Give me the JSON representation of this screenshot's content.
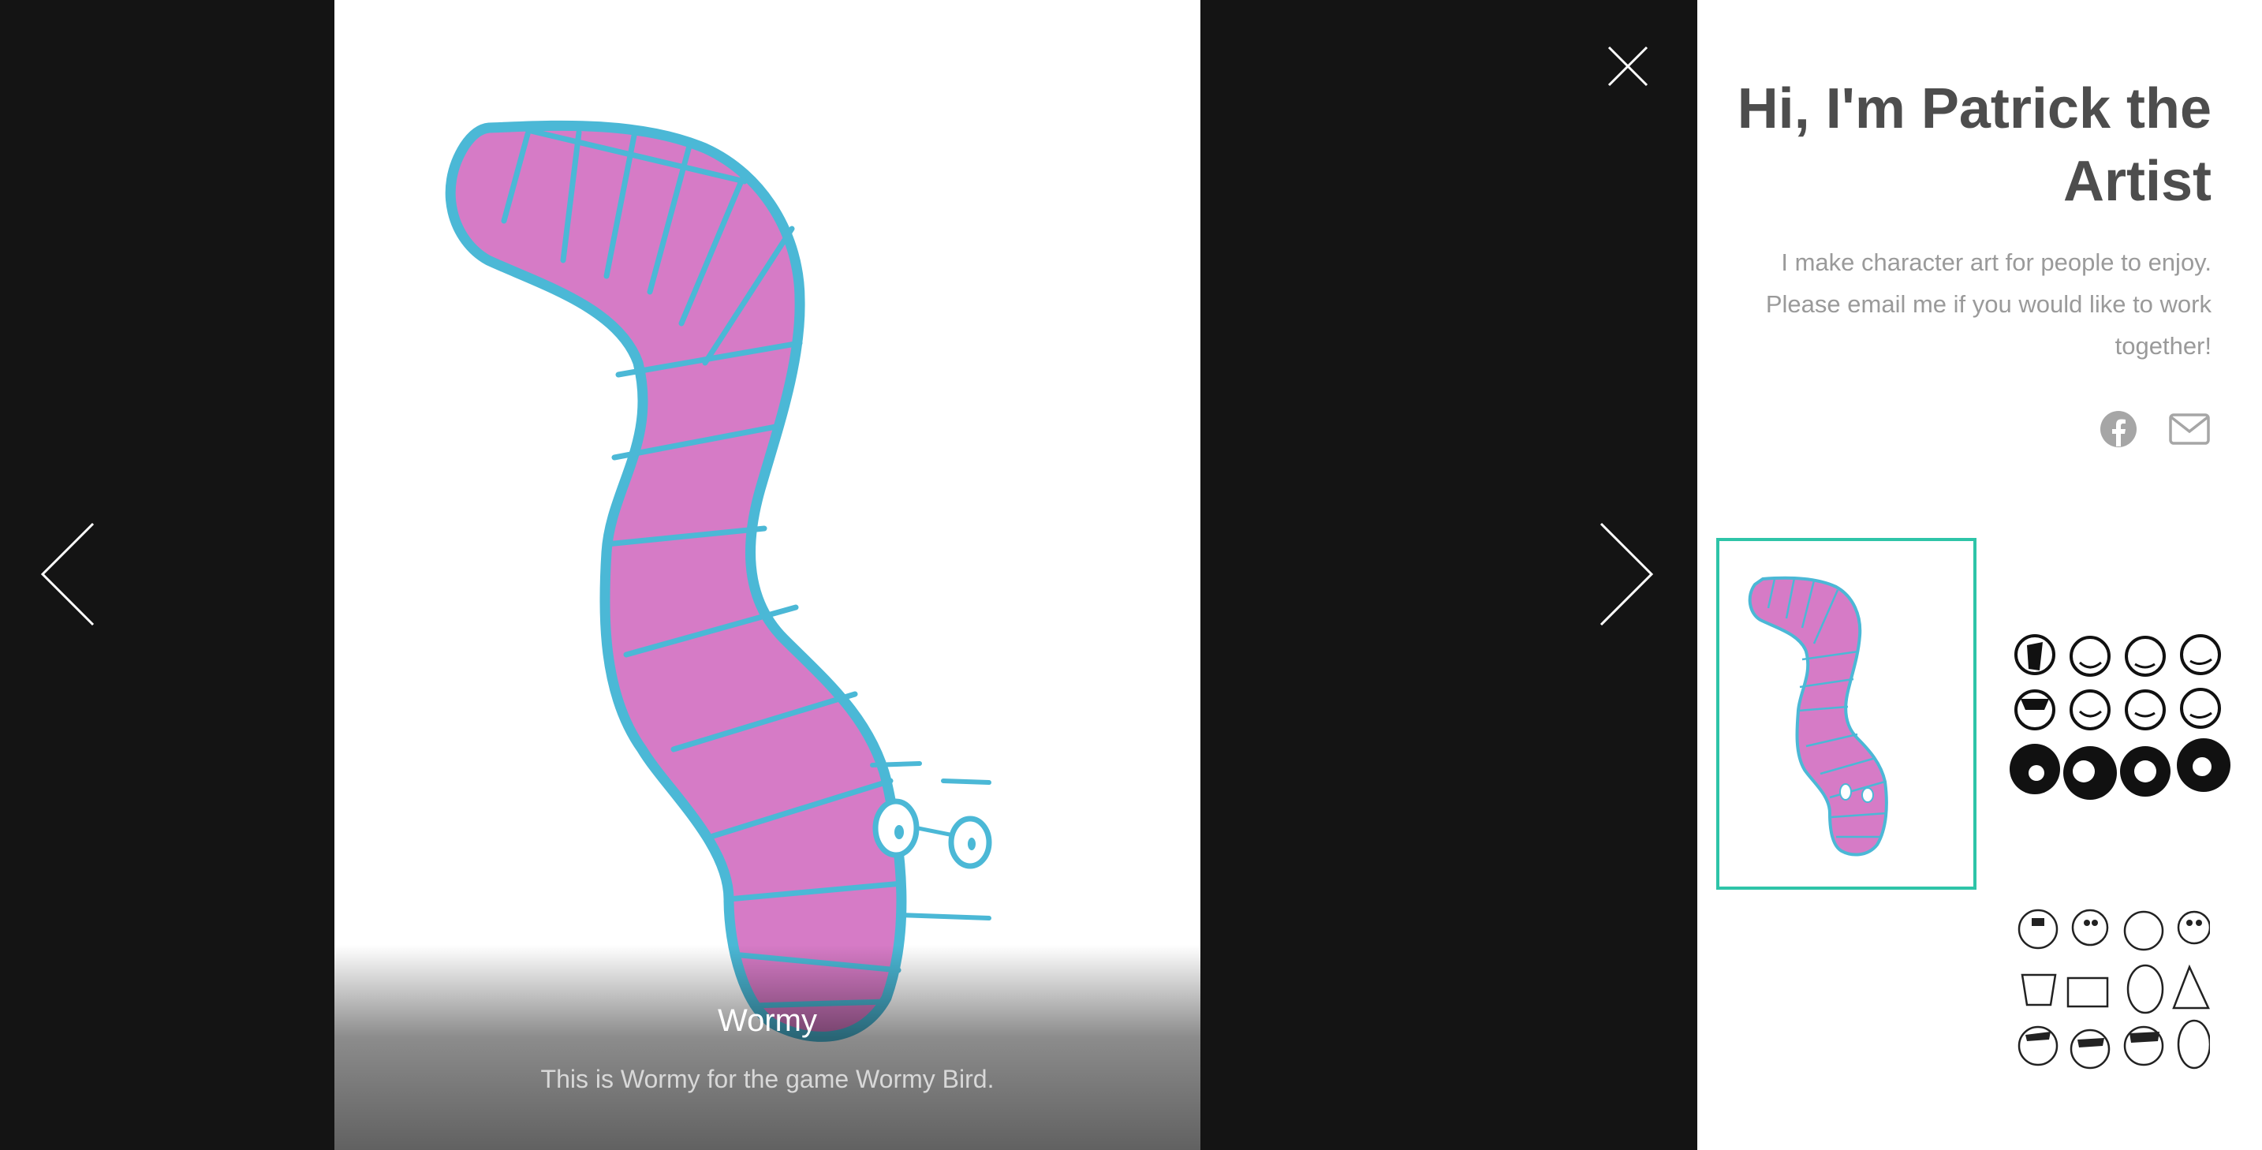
{
  "lightbox": {
    "caption_title": "Wormy",
    "caption_description": "This is Wormy for the game Wormy Bird.",
    "icons": {
      "previous": "chevron-left-icon",
      "next": "chevron-right-icon",
      "close": "close-icon"
    }
  },
  "sidebar": {
    "title": "Hi, I'm Patrick the Artist",
    "description": "I make character art for people to enjoy. Please email me if you would like to work together!",
    "social": [
      {
        "name": "facebook",
        "icon": "facebook-icon"
      },
      {
        "name": "email",
        "icon": "mail-icon"
      }
    ],
    "thumbnails": [
      {
        "name": "Wormy",
        "selected": true
      },
      {
        "name": "faces-dark",
        "selected": false
      },
      {
        "name": "faces-light",
        "selected": false
      }
    ]
  },
  "colors": {
    "background_dark": "#141414",
    "worm_fill": "#d67bc6",
    "worm_outline": "#4bb8d6",
    "selected_border": "#2ec4a8",
    "title_text": "#4d4d4d",
    "description_text": "#9a9a9a",
    "icon_gray": "#a6a6a6"
  }
}
